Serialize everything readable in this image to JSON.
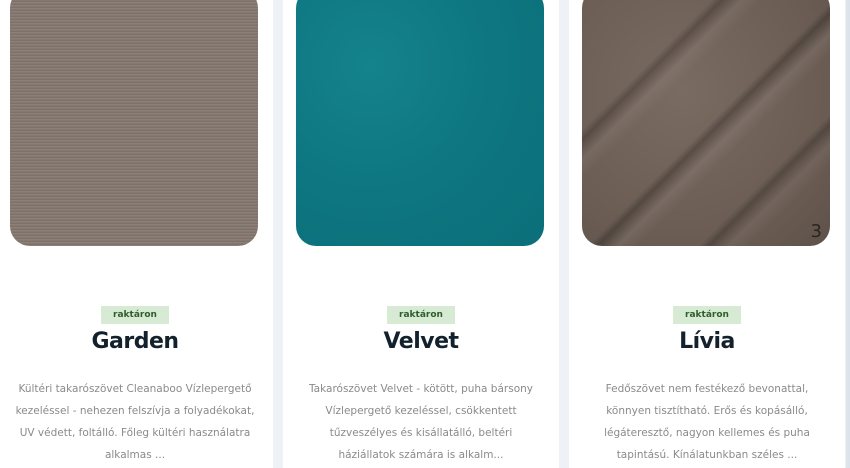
{
  "products": [
    {
      "badge": "raktáron",
      "title": "Garden",
      "description": "Kültéri takarószövet Cleanaboo Vízlepergető kezeléssel - nehezen felszívja a folyadékokat, UV védett, foltálló. Főleg kültéri használatra alkalmas ...",
      "swatch_color": "#857871"
    },
    {
      "badge": "raktáron",
      "title": "Velvet",
      "description": "Takarószövet Velvet - kötött, puha bársony Vízlepergető kezeléssel, csökkentett tűzveszélyes és kisállatálló, beltéri háziállatok számára is alkalm...",
      "swatch_color": "#0e7782"
    },
    {
      "badge": "raktáron",
      "title": "Lívia",
      "description": "Fedőszövet nem festékező bevonattal, könnyen tisztítható. Erős és kopásálló, légáteresztő, nagyon kellemes és puha tapintású. Kínálatunkban széles ...",
      "swatch_color": "#6e6057",
      "image_count": "3"
    }
  ],
  "colors": {
    "badge_bg": "#d7ebd4",
    "badge_text": "#2f5e2c",
    "title": "#13212c",
    "description": "#8a8a8a",
    "page_bg": "#eef2f6"
  }
}
